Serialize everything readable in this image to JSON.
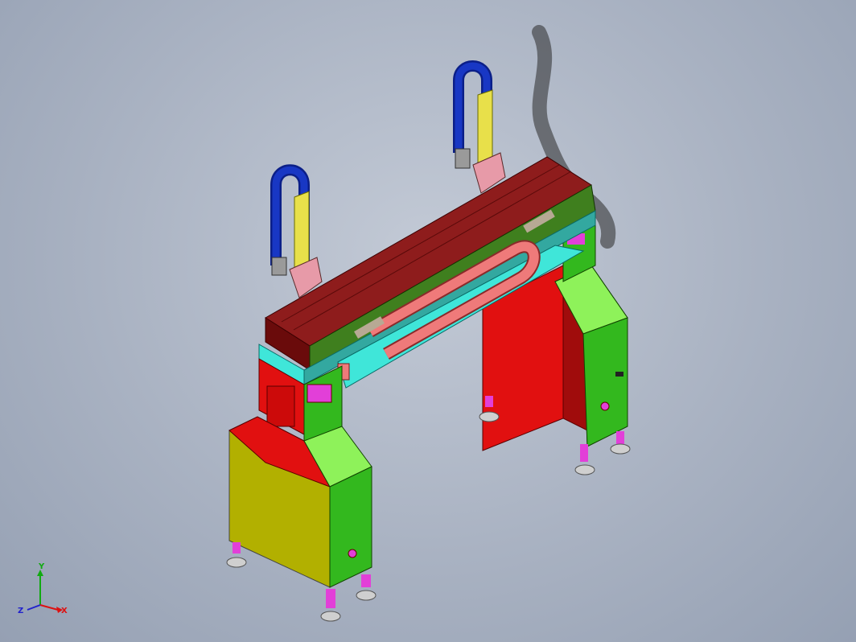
{
  "viewport": {
    "background": "#a9b2c2",
    "model": "gantry-machine-assembly"
  },
  "colors": {
    "beam": "#7a0f0f",
    "beam_top": "#8e1c1c",
    "rail_green": "#3f7f1e",
    "cyan_tray": "#3fe6d9",
    "cable_chain": "#ef7a7a",
    "column_red": "#e11010",
    "column_green": "#33b81e",
    "column_lime": "#8ef25a",
    "box_yellow": "#b2b000",
    "magenta": "#e23fd8",
    "blue_handle": "#1837c4",
    "yellow_post": "#e8e04a",
    "pink_bracket": "#e79aa8",
    "foot_gray": "#cfcfcf"
  },
  "triad": {
    "x_label": "X",
    "y_label": "Y",
    "z_label": "Z",
    "x_color": "#d11",
    "y_color": "#1a1",
    "z_color": "#22c"
  }
}
